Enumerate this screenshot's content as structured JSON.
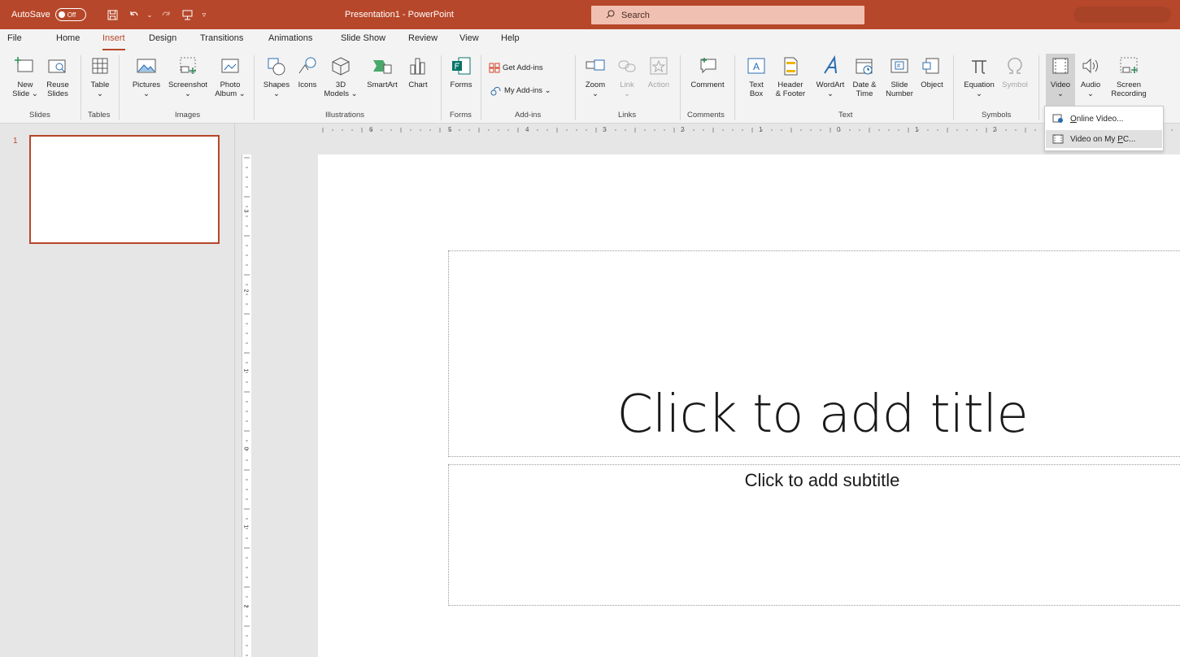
{
  "titlebar": {
    "autosave_label": "AutoSave",
    "autosave_state": "Off",
    "window_title": "Presentation1 - PowerPoint",
    "search_placeholder": "Search"
  },
  "tabs": [
    "File",
    "Home",
    "Insert",
    "Design",
    "Transitions",
    "Animations",
    "Slide Show",
    "Review",
    "View",
    "Help"
  ],
  "active_tab": "Insert",
  "ribbon": {
    "new_slide": [
      "New",
      "Slide ⌄"
    ],
    "reuse_slides": [
      "Reuse",
      "Slides"
    ],
    "table": [
      "Table",
      "⌄"
    ],
    "pictures": [
      "Pictures",
      "⌄"
    ],
    "screenshot": [
      "Screenshot",
      "⌄"
    ],
    "photo_album": [
      "Photo",
      "Album ⌄"
    ],
    "shapes": [
      "Shapes",
      "⌄"
    ],
    "icons": "Icons",
    "models_3d": [
      "3D",
      "Models ⌄"
    ],
    "smartart": "SmartArt",
    "chart": "Chart",
    "forms": "Forms",
    "get_addins": "Get Add-ins",
    "my_addins": "My Add-ins ⌄",
    "zoom": [
      "Zoom",
      "⌄"
    ],
    "link": [
      "Link",
      "⌄"
    ],
    "action": "Action",
    "comment": "Comment",
    "text_box": [
      "Text",
      "Box"
    ],
    "header_footer": [
      "Header",
      "& Footer"
    ],
    "wordart": [
      "WordArt",
      "⌄"
    ],
    "date_time": [
      "Date &",
      "Time"
    ],
    "slide_number": [
      "Slide",
      "Number"
    ],
    "object": "Object",
    "equation": [
      "Equation",
      "⌄"
    ],
    "symbol": "Symbol",
    "video": [
      "Video",
      "⌄"
    ],
    "audio": [
      "Audio",
      "⌄"
    ],
    "screen_recording": [
      "Screen",
      "Recording"
    ],
    "groups": {
      "slides": "Slides",
      "tables": "Tables",
      "images": "Images",
      "illustrations": "Illustrations",
      "forms": "Forms",
      "addins": "Add-ins",
      "links": "Links",
      "comments": "Comments",
      "text": "Text",
      "symbols": "Symbols"
    }
  },
  "video_menu": {
    "online_prefix": "O",
    "online_rest": "nline Video...",
    "pc_prefix": "Video on My ",
    "pc_key": "P",
    "pc_rest": "C..."
  },
  "thumbnail": {
    "number": "1"
  },
  "ruler": {
    "horizontal": [
      "6",
      "5",
      "4",
      "3",
      "2",
      "1",
      "0",
      "1",
      "2"
    ],
    "vertical": [
      "3",
      "2",
      "1",
      "0",
      "1",
      "2"
    ]
  },
  "slide": {
    "title_placeholder": "Click to add title",
    "subtitle_placeholder": "Click to add subtitle"
  }
}
